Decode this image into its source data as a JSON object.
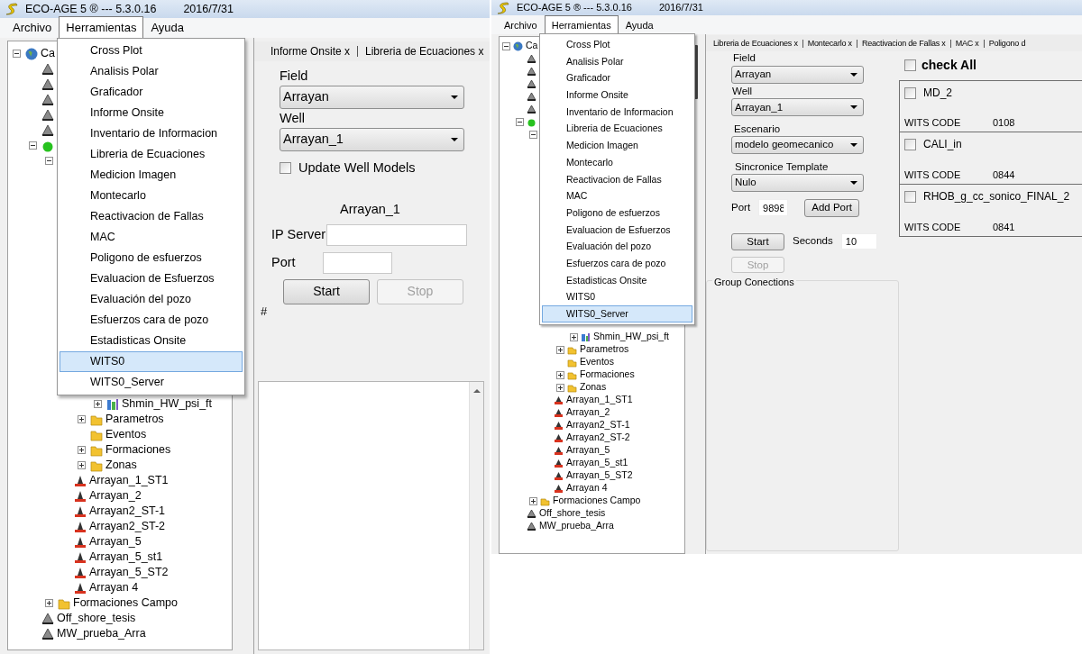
{
  "left_screen": {
    "window": {
      "title": "ECO-AGE 5 ® --- 5.3.0.16",
      "date": "2016/7/31"
    },
    "menubar": [
      {
        "label": "Archivo",
        "selected": false
      },
      {
        "label": "Herramientas",
        "selected": true
      },
      {
        "label": "Ayuda",
        "selected": false
      }
    ],
    "menu": [
      {
        "label": "Cross Plot",
        "selected": false
      },
      {
        "label": "Analisis Polar",
        "selected": false
      },
      {
        "label": "Graficador",
        "selected": false
      },
      {
        "label": "Informe Onsite",
        "selected": false
      },
      {
        "label": "Inventario de Informacion",
        "selected": false
      },
      {
        "label": "Libreria de Ecuaciones",
        "selected": false
      },
      {
        "label": "Medicion Imagen",
        "selected": false
      },
      {
        "label": "Montecarlo",
        "selected": false
      },
      {
        "label": "Reactivacion de Fallas",
        "selected": false
      },
      {
        "label": "MAC",
        "selected": false
      },
      {
        "label": "Poligono de esfuerzos",
        "selected": false
      },
      {
        "label": "Evaluacion de Esfuerzos",
        "selected": false
      },
      {
        "label": "Evaluación del pozo",
        "selected": false
      },
      {
        "label": "Esfuerzos cara de pozo",
        "selected": false
      },
      {
        "label": "Estadisticas Onsite",
        "selected": false
      },
      {
        "label": "WITS0",
        "selected": true
      },
      {
        "label": "WITS0_Server",
        "selected": false
      }
    ],
    "tree": {
      "label": "Ca",
      "kind": "globe",
      "expanded": true,
      "children": [
        {
          "kind": "cone"
        },
        {
          "kind": "cone"
        },
        {
          "kind": "cone"
        },
        {
          "kind": "cone"
        },
        {
          "kind": "cone"
        },
        {
          "kind": "green",
          "expanded": true,
          "children": [
            {
              "expanded": true,
              "children": [
                {
                  "children": [
                    {
                      "children": [
                        {
                          "label": "Shmin_HW_psi_ft",
                          "kind": "log",
                          "expanded": false
                        }
                      ]
                    },
                    {
                      "label": "Parametros",
                      "kind": "folder",
                      "expanded": false
                    },
                    {
                      "label": "Eventos",
                      "kind": "folder"
                    },
                    {
                      "label": "Formaciones",
                      "kind": "folder",
                      "expanded": false
                    },
                    {
                      "label": "Zonas",
                      "kind": "folder",
                      "expanded": false
                    }
                  ]
                },
                {
                  "label": "Arrayan_1_ST1",
                  "kind": "well"
                },
                {
                  "label": "Arrayan_2",
                  "kind": "well"
                },
                {
                  "label": "Arrayan2_ST-1",
                  "kind": "well"
                },
                {
                  "label": "Arrayan2_ST-2",
                  "kind": "well"
                },
                {
                  "label": "Arrayan_5",
                  "kind": "well"
                },
                {
                  "label": "Arrayan_5_st1",
                  "kind": "well"
                },
                {
                  "label": "Arrayan_5_ST2",
                  "kind": "well"
                },
                {
                  "label": "Arrayan 4",
                  "kind": "well"
                }
              ]
            },
            {
              "label": "Formaciones Campo",
              "kind": "folder",
              "expanded": false
            }
          ]
        },
        {
          "label": "Off_shore_tesis",
          "kind": "cone"
        },
        {
          "label": "MW_prueba_Arra",
          "kind": "cone"
        }
      ]
    },
    "tabs": [
      {
        "label": "Informe Onsite x"
      },
      {
        "label": "Libreria de Ecuaciones x"
      }
    ],
    "form": {
      "field": {
        "label": "Field",
        "value": "Arrayan"
      },
      "well": {
        "label": "Well",
        "value": "Arrayan_1"
      },
      "update": {
        "label": "Update Well Models",
        "checked": false
      },
      "well_title": "Arrayan_1",
      "ip_server": {
        "label": "IP Server"
      },
      "port": {
        "label": "Port"
      },
      "start": {
        "label": "Start",
        "disabled": false
      },
      "stop": {
        "label": "Stop",
        "disabled": true
      },
      "hash": "#"
    }
  },
  "right_screen": {
    "window": {
      "title": "ECO-AGE 5 ® --- 5.3.0.16",
      "date": "2016/7/31"
    },
    "menubar": [
      {
        "label": "Archivo",
        "selected": false
      },
      {
        "label": "Herramientas",
        "selected": true
      },
      {
        "label": "Ayuda",
        "selected": false
      }
    ],
    "menu": [
      {
        "label": "Cross Plot",
        "selected": false
      },
      {
        "label": "Analisis Polar",
        "selected": false
      },
      {
        "label": "Graficador",
        "selected": false
      },
      {
        "label": "Informe Onsite",
        "selected": false
      },
      {
        "label": "Inventario de Informacion",
        "selected": false
      },
      {
        "label": "Libreria de Ecuaciones",
        "selected": false
      },
      {
        "label": "Medicion Imagen",
        "selected": false
      },
      {
        "label": "Montecarlo",
        "selected": false
      },
      {
        "label": "Reactivacion de Fallas",
        "selected": false
      },
      {
        "label": "MAC",
        "selected": false
      },
      {
        "label": "Poligono de esfuerzos",
        "selected": false
      },
      {
        "label": "Evaluacion de Esfuerzos",
        "selected": false
      },
      {
        "label": "Evaluación del pozo",
        "selected": false
      },
      {
        "label": "Esfuerzos cara de pozo",
        "selected": false
      },
      {
        "label": "Estadisticas Onsite",
        "selected": false
      },
      {
        "label": "WITS0",
        "selected": false
      },
      {
        "label": "WITS0_Server",
        "selected": true
      }
    ],
    "tree": {
      "label": "Ca",
      "kind": "globe",
      "expanded": true,
      "children": [
        {
          "kind": "cone"
        },
        {
          "kind": "cone"
        },
        {
          "kind": "cone"
        },
        {
          "kind": "cone"
        },
        {
          "kind": "cone"
        },
        {
          "kind": "green",
          "expanded": true,
          "children": [
            {
              "expanded": true,
              "children": [
                {
                  "children": [
                    {
                      "children": [
                        {
                          "label": "Shmin_HW_psi_ft",
                          "kind": "log",
                          "expanded": false
                        }
                      ]
                    },
                    {
                      "label": "Parametros",
                      "kind": "folder",
                      "expanded": false
                    },
                    {
                      "label": "Eventos",
                      "kind": "folder"
                    },
                    {
                      "label": "Formaciones",
                      "kind": "folder",
                      "expanded": false
                    },
                    {
                      "label": "Zonas",
                      "kind": "folder",
                      "expanded": false
                    }
                  ]
                },
                {
                  "label": "Arrayan_1_ST1",
                  "kind": "well"
                },
                {
                  "label": "Arrayan_2",
                  "kind": "well"
                },
                {
                  "label": "Arrayan2_ST-1",
                  "kind": "well"
                },
                {
                  "label": "Arrayan2_ST-2",
                  "kind": "well"
                },
                {
                  "label": "Arrayan_5",
                  "kind": "well"
                },
                {
                  "label": "Arrayan_5_st1",
                  "kind": "well"
                },
                {
                  "label": "Arrayan_5_ST2",
                  "kind": "well"
                },
                {
                  "label": "Arrayan 4",
                  "kind": "well"
                }
              ]
            },
            {
              "label": "Formaciones Campo",
              "kind": "folder",
              "expanded": false
            }
          ]
        },
        {
          "label": "Off_shore_tesis",
          "kind": "cone"
        },
        {
          "label": "MW_prueba_Arra",
          "kind": "cone"
        }
      ]
    },
    "tabs": [
      {
        "label": "Libreria de Ecuaciones x"
      },
      {
        "label": "Montecarlo  x"
      },
      {
        "label": "Reactivacion de Fallas x"
      },
      {
        "label": "MAC  x"
      },
      {
        "label": "Poligono d"
      }
    ],
    "form": {
      "field": {
        "label": "Field",
        "value": "Arrayan"
      },
      "well": {
        "label": "Well",
        "value": "Arrayan_1"
      },
      "escenario": {
        "label": "Escenario",
        "value": "modelo geomecanico"
      },
      "template": {
        "label": "Sincronice Template",
        "value": "Nulo"
      },
      "port": {
        "label": "Port",
        "value": "9898"
      },
      "add_port": "Add Port",
      "start": {
        "label": "Start",
        "disabled": false
      },
      "seconds": {
        "label": "Seconds",
        "value": "10"
      },
      "stop": {
        "label": "Stop",
        "disabled": true
      }
    },
    "group": "Group Conections",
    "check_all": {
      "label": "check All",
      "checked": false
    },
    "channels": [
      {
        "name": "MD_2",
        "checked": false,
        "code_label": "WITS CODE",
        "code": "0108"
      },
      {
        "name": "CALI_in",
        "checked": false,
        "code_label": "WITS CODE",
        "code": "0844"
      },
      {
        "name": "RHOB_g_cc_sonico_FINAL_2",
        "checked": false,
        "code_label": "WITS CODE",
        "code": "0841"
      }
    ]
  }
}
